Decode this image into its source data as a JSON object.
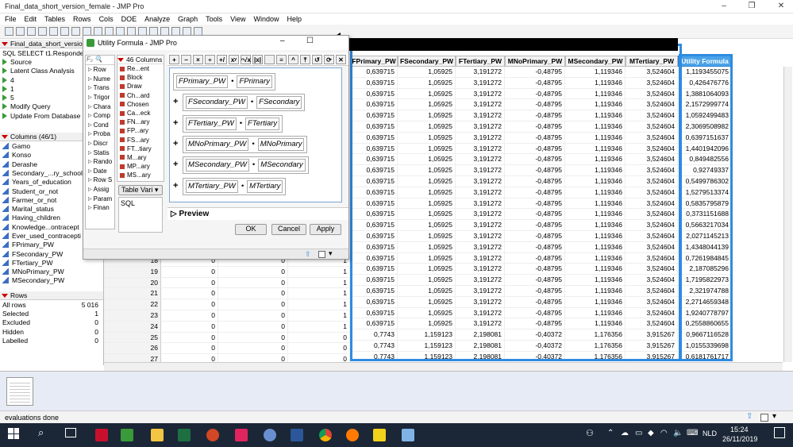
{
  "window": {
    "title": "Final_data_short_version_female - JMP Pro"
  },
  "menu": [
    "File",
    "Edit",
    "Tables",
    "Rows",
    "Cols",
    "DOE",
    "Analyze",
    "Graph",
    "Tools",
    "View",
    "Window",
    "Help"
  ],
  "left_panel": {
    "table_name": "Final_data_short_versio",
    "table_items": [
      "SQL  SELECT t1.Responde",
      "Source",
      "Latent Class Analysis",
      "4",
      "1",
      "5",
      "Modify Query",
      "Update From Database"
    ],
    "columns_header": "Columns (46/1)",
    "columns": [
      "Gamo",
      "Konso",
      "Derashe",
      "Secondary_...ry_school",
      "Years_of_education",
      "Student_or_not",
      "Farmer_or_not",
      "Marital_status",
      "Having_children",
      "Knowledge...ontracept",
      "Ever_used_contracepti",
      "FPrimary_PW",
      "FSecondary_PW",
      "FTertiary_PW",
      "MNoPrimary_PW",
      "MSecondary_PW"
    ],
    "rows_header": "Rows",
    "rows_stats": [
      {
        "label": "All rows",
        "value": "5 016"
      },
      {
        "label": "Selected",
        "value": "1"
      },
      {
        "label": "Excluded",
        "value": "0"
      },
      {
        "label": "Hidden",
        "value": "0"
      },
      {
        "label": "Labelled",
        "value": "0"
      }
    ]
  },
  "dialog": {
    "title": "Utility Formula - JMP Pro",
    "functions": [
      "Row",
      "Nume",
      "Trans",
      "Trigor",
      "Chara",
      "Comp",
      "Cond",
      "Proba",
      "Discr",
      "Statis",
      "Rando",
      "Date",
      "Row S",
      "Assig",
      "Param",
      "Finan"
    ],
    "cols_header": "46 Columns",
    "cols": [
      "Re...ent",
      "Block",
      "Draw",
      "Ch...ard",
      "Chosen",
      "Ca...eck",
      "FN...ary",
      "FP...ary",
      "FS...ary",
      "FT...tiary",
      "M...ary",
      "MP...ary",
      "MS...ary"
    ],
    "table_vars_label": "Table Vari",
    "table_vars": [
      "SQL"
    ],
    "formula_terms": [
      {
        "a": "FPrimary_PW",
        "b": "FPrimary",
        "plus": false
      },
      {
        "a": "FSecondary_PW",
        "b": "FSecondary",
        "plus": true
      },
      {
        "a": "FTertiary_PW",
        "b": "FTertiary",
        "plus": true
      },
      {
        "a": "MNoPrimary_PW",
        "b": "MNoPrimary",
        "plus": true
      },
      {
        "a": "MSecondary_PW",
        "b": "MSecondary",
        "plus": true
      },
      {
        "a": "MTertiary_PW",
        "b": "MTertiary",
        "plus": true
      }
    ],
    "preview_label": "Preview",
    "ok": "OK",
    "cancel": "Cancel",
    "apply": "Apply"
  },
  "table": {
    "headers": [
      "FPrimary_PW",
      "FSecondary_PW",
      "FTertiary_PW",
      "MNoPrimary_PW",
      "MSecondary_PW",
      "MTertiary_PW",
      "Utility Formula"
    ],
    "rows": [
      [
        "0,639715",
        "1,05925",
        "3,191272",
        "-0,48795",
        "1,119346",
        "3,524604",
        "1,1193455075"
      ],
      [
        "0,639715",
        "1,05925",
        "3,191272",
        "-0,48795",
        "1,119346",
        "3,524604",
        "0,426476776"
      ],
      [
        "0,639715",
        "1,05925",
        "3,191272",
        "-0,48795",
        "1,119346",
        "3,524604",
        "1,3881064093"
      ],
      [
        "0,639715",
        "1,05925",
        "3,191272",
        "-0,48795",
        "1,119346",
        "3,524604",
        "2,1572999774"
      ],
      [
        "0,639715",
        "1,05925",
        "3,191272",
        "-0,48795",
        "1,119346",
        "3,524604",
        "1,0592499483"
      ],
      [
        "0,639715",
        "1,05925",
        "3,191272",
        "-0,48795",
        "1,119346",
        "3,524604",
        "2,3069508982"
      ],
      [
        "0,639715",
        "1,05925",
        "3,191272",
        "-0,48795",
        "1,119346",
        "3,524604",
        "0,6397151637"
      ],
      [
        "0,639715",
        "1,05925",
        "3,191272",
        "-0,48795",
        "1,119346",
        "3,524604",
        "1,4401942096"
      ],
      [
        "0,639715",
        "1,05925",
        "3,191272",
        "-0,48795",
        "1,119346",
        "3,524604",
        "0,849482556"
      ],
      [
        "0,639715",
        "1,05925",
        "3,191272",
        "-0,48795",
        "1,119346",
        "3,524604",
        "0,92749337"
      ],
      [
        "0,639715",
        "1,05925",
        "3,191272",
        "-0,48795",
        "1,119346",
        "3,524604",
        "0,5499786302"
      ],
      [
        "0,639715",
        "1,05925",
        "3,191272",
        "-0,48795",
        "1,119346",
        "3,524604",
        "1,5279513374"
      ],
      [
        "0,639715",
        "1,05925",
        "3,191272",
        "-0,48795",
        "1,119346",
        "3,524604",
        "0,5835795879"
      ],
      [
        "0,639715",
        "1,05925",
        "3,191272",
        "-0,48795",
        "1,119346",
        "3,524604",
        "0,3731151688"
      ],
      [
        "0,639715",
        "1,05925",
        "3,191272",
        "-0,48795",
        "1,119346",
        "3,524604",
        "0,5663217034"
      ],
      [
        "0,639715",
        "1,05925",
        "3,191272",
        "-0,48795",
        "1,119346",
        "3,524604",
        "2,0271145213"
      ],
      [
        "0,639715",
        "1,05925",
        "3,191272",
        "-0,48795",
        "1,119346",
        "3,524604",
        "1,4348044139"
      ],
      [
        "0,639715",
        "1,05925",
        "3,191272",
        "-0,48795",
        "1,119346",
        "3,524604",
        "0,7261984845"
      ],
      [
        "0,639715",
        "1,05925",
        "3,191272",
        "-0,48795",
        "1,119346",
        "3,524604",
        "2,187085296"
      ],
      [
        "0,639715",
        "1,05925",
        "3,191272",
        "-0,48795",
        "1,119346",
        "3,524604",
        "1,7195822973"
      ],
      [
        "0,639715",
        "1,05925",
        "3,191272",
        "-0,48795",
        "1,119346",
        "3,524604",
        "2,321974788"
      ],
      [
        "0,639715",
        "1,05925",
        "3,191272",
        "-0,48795",
        "1,119346",
        "3,524604",
        "2,2714659348"
      ],
      [
        "0,639715",
        "1,05925",
        "3,191272",
        "-0,48795",
        "1,119346",
        "3,524604",
        "1,9240778797"
      ],
      [
        "0,639715",
        "1,05925",
        "3,191272",
        "-0,48795",
        "1,119346",
        "3,524604",
        "0,2558860655"
      ],
      [
        "0,7743",
        "1,159123",
        "2,198081",
        "-0,40372",
        "1,176356",
        "3,915267",
        "0,9667116528"
      ],
      [
        "0,7743",
        "1,159123",
        "2,198081",
        "-0,40372",
        "1,176356",
        "3,915267",
        "1,0155339698"
      ],
      [
        "0,7743",
        "1,159123",
        "2,198081",
        "-0,40372",
        "1,176356",
        "3,915267",
        "0,6181761717"
      ]
    ],
    "left_rows": [
      [
        "18",
        "0",
        "0",
        "1",
        "0"
      ],
      [
        "19",
        "0",
        "0",
        "1",
        "0"
      ],
      [
        "20",
        "0",
        "0",
        "1",
        "0"
      ],
      [
        "21",
        "0",
        "0",
        "1",
        "0"
      ],
      [
        "22",
        "0",
        "0",
        "1",
        "0"
      ],
      [
        "23",
        "0",
        "0",
        "1",
        "0"
      ],
      [
        "24",
        "0",
        "0",
        "1",
        "0"
      ],
      [
        "25",
        "0",
        "0",
        "0",
        "0"
      ],
      [
        "26",
        "0",
        "0",
        "0",
        "0"
      ],
      [
        "27",
        "0",
        "0",
        "0",
        "0"
      ]
    ]
  },
  "status": {
    "text": "evaluations done"
  },
  "taskbar": {
    "lang": "NLD",
    "time": "15:24",
    "date": "26/11/2019"
  },
  "colors": {
    "accent": "#2f8be0",
    "highlight": "#4aa3e8",
    "arrow": "#000000"
  }
}
